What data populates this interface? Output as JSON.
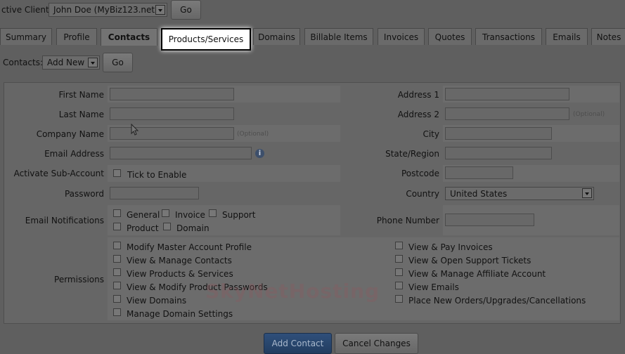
{
  "client_bar": {
    "label": "ctive Client:",
    "selected": "John Doe (MyBiz123.net)",
    "go": "Go"
  },
  "tabs": [
    "Summary",
    "Profile",
    "Contacts",
    "Products/Services",
    "Domains",
    "Billable Items",
    "Invoices",
    "Quotes",
    "Transactions",
    "Emails",
    "Notes"
  ],
  "contacts_bar": {
    "label": "Contacts:",
    "selected": "Add New",
    "go": "Go"
  },
  "form": {
    "first_name": "First Name",
    "last_name": "Last Name",
    "company_name": "Company Name",
    "email_address": "Email Address",
    "activate_sub": "Activate Sub-Account",
    "tick_enable": "Tick to Enable",
    "password": "Password",
    "email_notifications": "Email Notifications",
    "notif": {
      "general": "General",
      "invoice": "Invoice",
      "support": "Support",
      "product": "Product",
      "domain": "Domain"
    },
    "address1": "Address 1",
    "address2": "Address 2",
    "city": "City",
    "state": "State/Region",
    "postcode": "Postcode",
    "country": "Country",
    "country_value": "United States",
    "phone": "Phone Number",
    "optional": "(Optional)",
    "permissions": "Permissions",
    "perm_left": [
      "Modify Master Account Profile",
      "View & Manage Contacts",
      "View Products & Services",
      "View & Modify Product Passwords",
      "View Domains",
      "Manage Domain Settings"
    ],
    "perm_right": [
      "View & Pay Invoices",
      "View & Open Support Tickets",
      "View & Manage Affiliate Account",
      "View Emails",
      "Place New Orders/Upgrades/Cancellations"
    ]
  },
  "actions": {
    "add": "Add Contact",
    "cancel": "Cancel Changes"
  },
  "watermark": "SkyNetHosting"
}
